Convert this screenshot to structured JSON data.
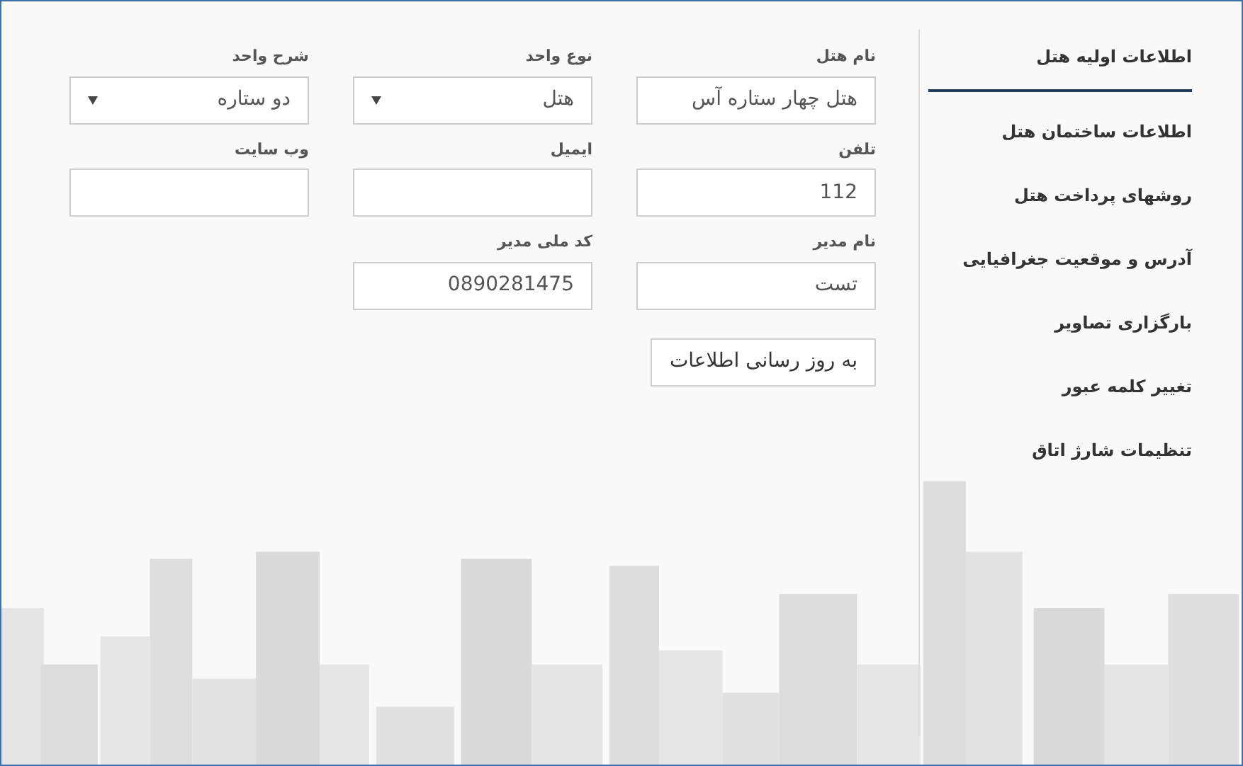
{
  "sidebar": {
    "items": [
      {
        "label": "اطلاعات اولیه هتل",
        "selected": true
      },
      {
        "label": "اطلاعات ساختمان هتل",
        "selected": false
      },
      {
        "label": "روشهای پرداخت هتل",
        "selected": false
      },
      {
        "label": "آدرس و موقعیت جغرافیایی",
        "selected": false
      },
      {
        "label": "بارگزاری تصاویر",
        "selected": false
      },
      {
        "label": "تغییر کلمه عبور",
        "selected": false
      },
      {
        "label": "تنظیمات شارژ اتاق",
        "selected": false
      }
    ]
  },
  "form": {
    "fields": [
      {
        "kind": "text",
        "label": "نام هتل",
        "value": "هتل چهار ستاره آس"
      },
      {
        "kind": "select",
        "label": "نوع واحد",
        "value": "هتل"
      },
      {
        "kind": "select",
        "label": "شرح واحد",
        "value": "دو ستاره"
      },
      {
        "kind": "text",
        "label": "تلفن",
        "value": "112"
      },
      {
        "kind": "text",
        "label": "ایمیل"
      },
      {
        "kind": "text",
        "label": "وب سایت"
      },
      {
        "kind": "text",
        "label": "نام مدیر",
        "value": "تست"
      },
      {
        "kind": "text",
        "label": "کد ملی مدیر",
        "value": "0890281475"
      }
    ],
    "submit_button": "به روز رسانی اطلاعات"
  }
}
